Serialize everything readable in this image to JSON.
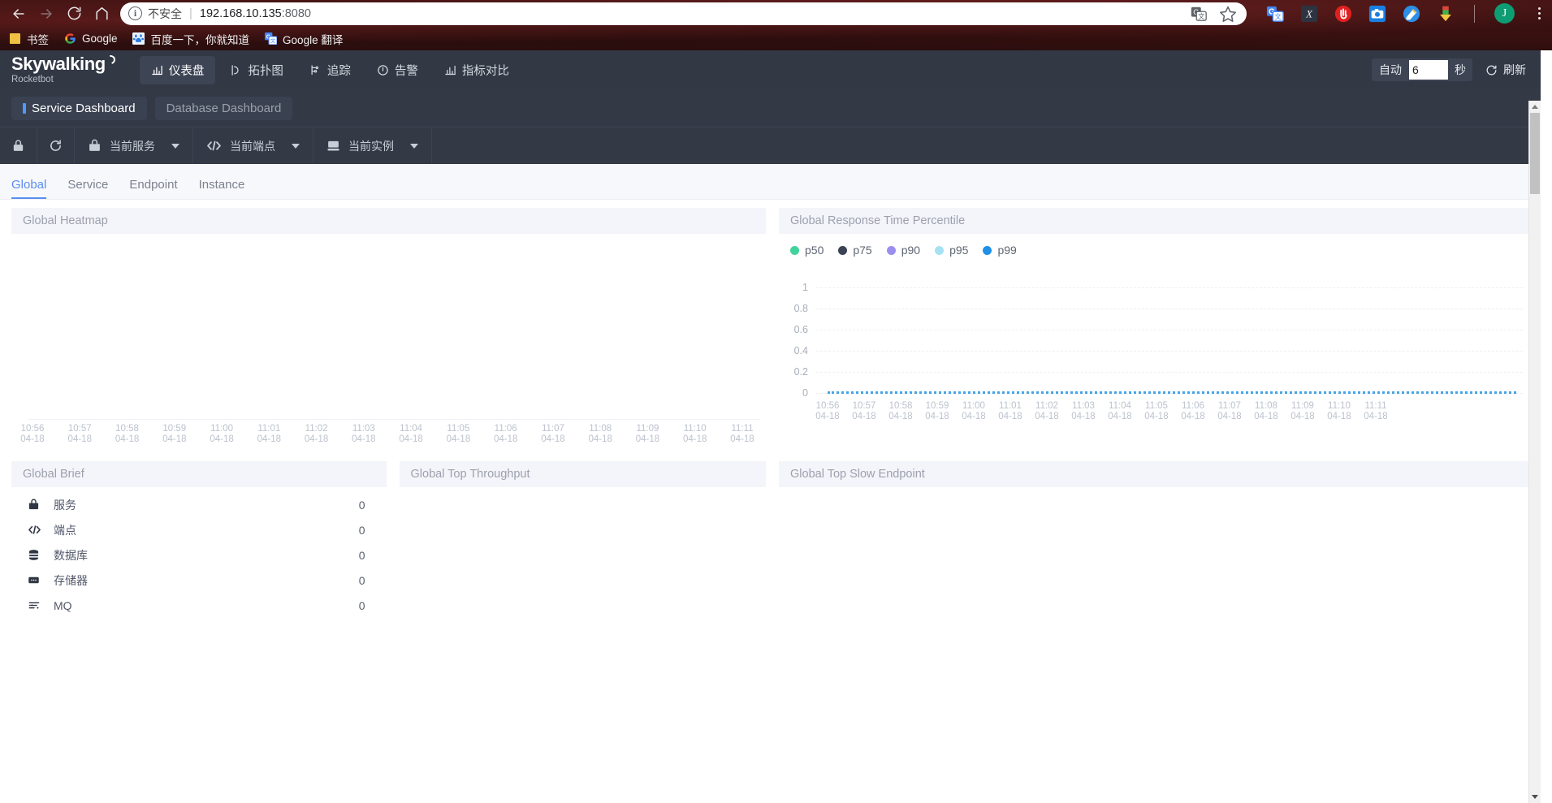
{
  "browser": {
    "nav": {
      "back": "back-arrow",
      "forward": "forward-arrow",
      "reload": "reload",
      "home": "home"
    },
    "omnibox": {
      "security_label": "不安全",
      "url_host": "192.168.10.135",
      "url_port": ":8080",
      "translate_icon": "translate-icon",
      "bookmark_star": "star-icon"
    },
    "extensions": [
      {
        "name": "google-translate-extension",
        "label": "G"
      },
      {
        "name": "x-extension",
        "label": "X"
      },
      {
        "name": "adblock-extension",
        "label": "stop-hand"
      },
      {
        "name": "screenshot-extension",
        "label": "camera"
      },
      {
        "name": "paint-extension",
        "label": "paint"
      },
      {
        "name": "download-extension",
        "label": "download"
      }
    ],
    "profile_initial": "J",
    "menu": "chrome-menu",
    "bookmarks": [
      {
        "label": "书签",
        "icon": "folder-icon"
      },
      {
        "label": "Google",
        "icon": "google-icon"
      },
      {
        "label": "百度一下，你就知道",
        "icon": "baidu-icon"
      },
      {
        "label": "Google 翻译",
        "icon": "gtranslate-icon"
      }
    ]
  },
  "app": {
    "logo": {
      "main": "Skywalking",
      "sub": "Rocketbot"
    },
    "nav": [
      {
        "label": "仪表盘",
        "icon": "dashboard-icon",
        "active": true
      },
      {
        "label": "拓扑图",
        "icon": "topology-icon",
        "active": false
      },
      {
        "label": "追踪",
        "icon": "trace-icon",
        "active": false
      },
      {
        "label": "告警",
        "icon": "alarm-icon",
        "active": false
      },
      {
        "label": "指标对比",
        "icon": "compare-icon",
        "active": false
      }
    ],
    "refresh": {
      "auto_label": "自动",
      "interval_value": "6",
      "unit_label": "秒",
      "refresh_label": "刷新",
      "refresh_icon": "refresh-icon"
    },
    "dashboard_tabs": [
      {
        "label": "Service Dashboard",
        "active": true
      },
      {
        "label": "Database Dashboard",
        "active": false
      }
    ],
    "selectors": {
      "lock_icon": "lock-icon",
      "reload_icon": "reload-icon",
      "service": {
        "label": "当前服务",
        "icon": "service-icon"
      },
      "endpoint": {
        "label": "当前端点",
        "icon": "endpoint-icon"
      },
      "instance": {
        "label": "当前实例",
        "icon": "instance-icon"
      }
    },
    "content_tabs": [
      {
        "label": "Global",
        "active": true
      },
      {
        "label": "Service",
        "active": false
      },
      {
        "label": "Endpoint",
        "active": false
      },
      {
        "label": "Instance",
        "active": false
      }
    ],
    "panels": {
      "heatmap_title": "Global Heatmap",
      "percentile_title": "Global Response Time Percentile",
      "brief_title": "Global Brief",
      "top_throughput_title": "Global Top Throughput",
      "top_slow_endpoint_title": "Global Top Slow Endpoint"
    },
    "brief": {
      "rows": [
        {
          "icon": "service-icon",
          "label": "服务",
          "value": "0"
        },
        {
          "icon": "endpoint-icon",
          "label": "端点",
          "value": "0"
        },
        {
          "icon": "database-icon",
          "label": "数据库",
          "value": "0"
        },
        {
          "icon": "cache-icon",
          "label": "存储器",
          "value": "0"
        },
        {
          "icon": "mq-icon",
          "label": "MQ",
          "value": "0"
        }
      ]
    }
  },
  "chart_data": [
    {
      "type": "heatmap",
      "title": "Global Heatmap",
      "xlabel": "",
      "ylabel": "",
      "grid": true,
      "legend_position": "none",
      "x": [
        "10:56\n04-18",
        "10:57\n04-18",
        "10:58\n04-18",
        "10:59\n04-18",
        "11:00\n04-18",
        "11:01\n04-18",
        "11:02\n04-18",
        "11:03\n04-18",
        "11:04\n04-18",
        "11:05\n04-18",
        "11:06\n04-18",
        "11:07\n04-18",
        "11:08\n04-18",
        "11:09\n04-18",
        "11:10\n04-18",
        "11:11\n04-18"
      ],
      "x_times": [
        "10:56",
        "10:57",
        "10:58",
        "10:59",
        "11:00",
        "11:01",
        "11:02",
        "11:03",
        "11:04",
        "11:05",
        "11:06",
        "11:07",
        "11:08",
        "11:09",
        "11:10",
        "11:11"
      ],
      "x_dates": [
        "04-18",
        "04-18",
        "04-18",
        "04-18",
        "04-18",
        "04-18",
        "04-18",
        "04-18",
        "04-18",
        "04-18",
        "04-18",
        "04-18",
        "04-18",
        "04-18",
        "04-18",
        "04-18"
      ],
      "cells": [],
      "note": "no heatmap data rendered"
    },
    {
      "type": "line",
      "title": "Global Response Time Percentile",
      "xlabel": "",
      "ylabel": "",
      "ylim": [
        0,
        1
      ],
      "yticks": [
        "1",
        "0.8",
        "0.6",
        "0.4",
        "0.2",
        "0"
      ],
      "ytick_values": [
        1,
        0.8,
        0.6,
        0.4,
        0.2,
        0
      ],
      "grid": true,
      "legend_position": "top-left",
      "x": [
        "10:56\n04-18",
        "10:57\n04-18",
        "10:58\n04-18",
        "10:59\n04-18",
        "11:00\n04-18",
        "11:01\n04-18",
        "11:02\n04-18",
        "11:03\n04-18",
        "11:04\n04-18",
        "11:05\n04-18",
        "11:06\n04-18",
        "11:07\n04-18",
        "11:08\n04-18",
        "11:09\n04-18",
        "11:10\n04-18",
        "11:11\n04-18"
      ],
      "x_times": [
        "10:56",
        "10:57",
        "10:58",
        "10:59",
        "11:00",
        "11:01",
        "11:02",
        "11:03",
        "11:04",
        "11:05",
        "11:06",
        "11:07",
        "11:08",
        "11:09",
        "11:10",
        "11:11"
      ],
      "x_dates": [
        "04-18",
        "04-18",
        "04-18",
        "04-18",
        "04-18",
        "04-18",
        "04-18",
        "04-18",
        "04-18",
        "04-18",
        "04-18",
        "04-18",
        "04-18",
        "04-18",
        "04-18",
        "04-18"
      ],
      "series": [
        {
          "name": "p50",
          "color": "#42d39c",
          "values": [
            0,
            0,
            0,
            0,
            0,
            0,
            0,
            0,
            0,
            0,
            0,
            0,
            0,
            0,
            0,
            0
          ]
        },
        {
          "name": "p75",
          "color": "#3b4355",
          "values": [
            0,
            0,
            0,
            0,
            0,
            0,
            0,
            0,
            0,
            0,
            0,
            0,
            0,
            0,
            0,
            0
          ]
        },
        {
          "name": "p90",
          "color": "#9b8ef0",
          "values": [
            0,
            0,
            0,
            0,
            0,
            0,
            0,
            0,
            0,
            0,
            0,
            0,
            0,
            0,
            0,
            0
          ]
        },
        {
          "name": "p95",
          "color": "#a6e2f2",
          "values": [
            0,
            0,
            0,
            0,
            0,
            0,
            0,
            0,
            0,
            0,
            0,
            0,
            0,
            0,
            0,
            0
          ]
        },
        {
          "name": "p99",
          "color": "#1e90e8",
          "values": [
            0,
            0,
            0,
            0,
            0,
            0,
            0,
            0,
            0,
            0,
            0,
            0,
            0,
            0,
            0,
            0
          ]
        }
      ]
    }
  ],
  "colors": {
    "accent": "#5a8ef0",
    "header_bg": "#323844",
    "panel_head_bg": "#f4f5fa",
    "line": "#3ba0e8"
  }
}
